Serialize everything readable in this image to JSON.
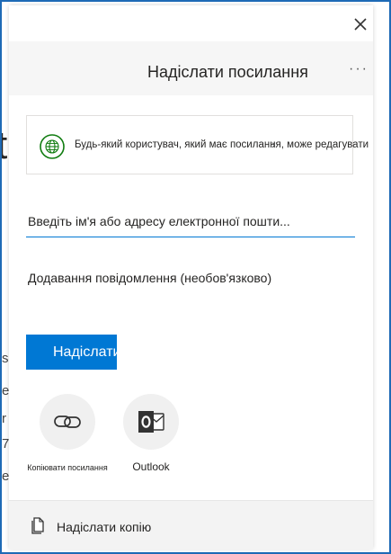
{
  "dialog": {
    "title": "Надіслати посилання",
    "more_label": "···"
  },
  "permission": {
    "text": "Будь-який користувач, який має посилання, може редагувати",
    "icon": "globe-icon",
    "accent": "#107c10"
  },
  "recipients": {
    "placeholder": "Введіть ім'я або адресу електронної пошти..."
  },
  "message": {
    "placeholder": "Додавання повідомлення (необов'язково)"
  },
  "send": {
    "label": "Надіслати",
    "color": "#0078d4"
  },
  "share_options": [
    {
      "label": "Копіювати посилання",
      "icon": "link-icon"
    },
    {
      "label": "Outlook",
      "icon": "outlook-icon",
      "color": "#0364b8"
    }
  ],
  "footer": {
    "label": "Надіслати копію",
    "icon": "copy-icon"
  }
}
